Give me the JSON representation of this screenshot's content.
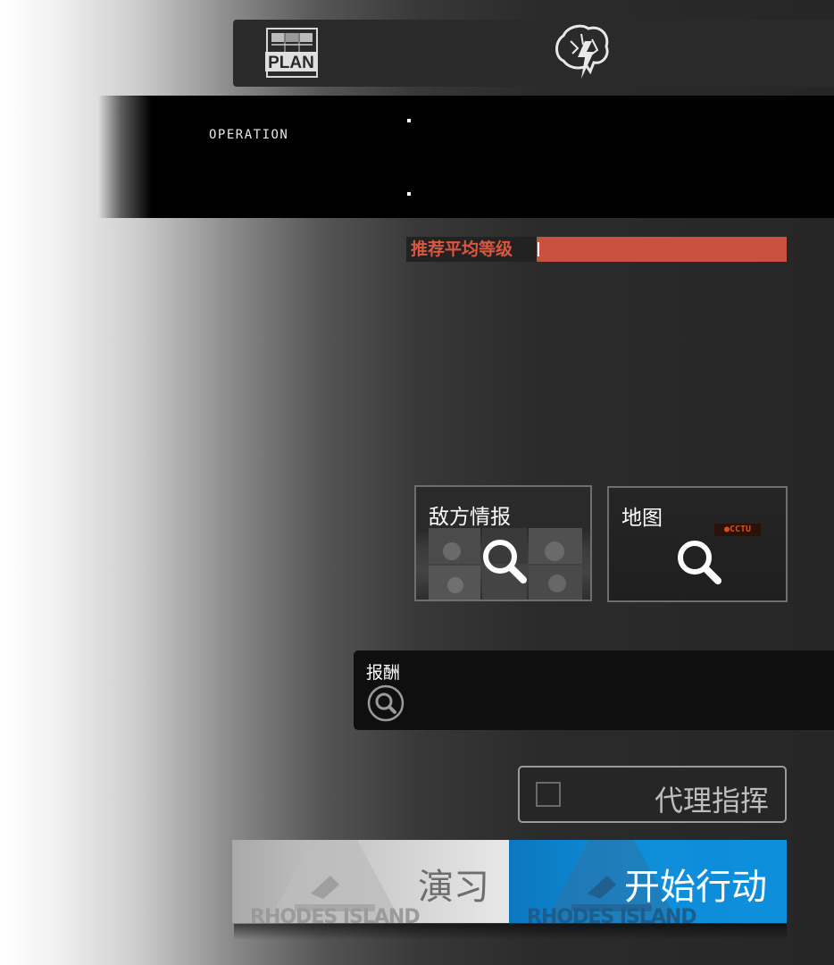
{
  "topbar": {
    "plan_icon_text": "PLAN",
    "icons": [
      "plan-board-icon",
      "brain-lightning-icon"
    ]
  },
  "operation": {
    "label": "OPERATION"
  },
  "level": {
    "label": "推荐平均等级"
  },
  "cards": {
    "enemy": {
      "title": "敌方情报",
      "icon": "magnifier-icon"
    },
    "map": {
      "title": "地图",
      "badge": "●CCTU",
      "icon": "magnifier-icon"
    }
  },
  "reward": {
    "label": "报酬",
    "icon": "magnifier-circle-icon"
  },
  "proxy": {
    "label": "代理指挥",
    "checked": false
  },
  "buttons": {
    "practice": {
      "label": "演习",
      "bg_text": "RHODES ISLAND"
    },
    "start": {
      "label": "开始行动",
      "bg_text": "RHODES ISLAND"
    }
  },
  "colors": {
    "level_bar": "#c9513f",
    "start_button": "#0f8ed8",
    "practice_button": "#e8e8e8"
  }
}
